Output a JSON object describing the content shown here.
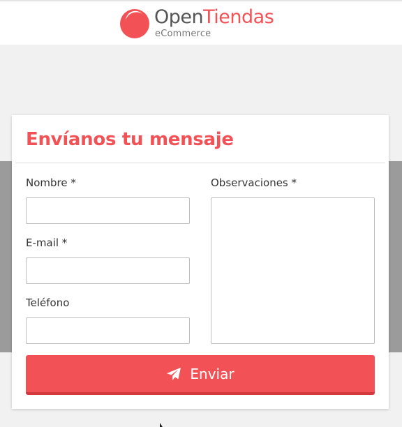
{
  "brand": {
    "name_part1": "Open",
    "name_part2": "Tiendas",
    "subtitle": "eCommerce",
    "colors": {
      "accent": "#f25256",
      "dark": "#555555",
      "muted": "#777777"
    }
  },
  "form": {
    "title": "Envíanos tu mensaje",
    "fields": {
      "name_label": "Nombre *",
      "email_label": "E-mail *",
      "phone_label": "Teléfono",
      "notes_label": "Observaciones *"
    },
    "submit_label": "Enviar",
    "submit_icon": "paper-plane-icon"
  },
  "colors": {
    "band": "#9b9b9b",
    "background": "#f1f1f1",
    "button_shadow": "#d23a3e"
  }
}
